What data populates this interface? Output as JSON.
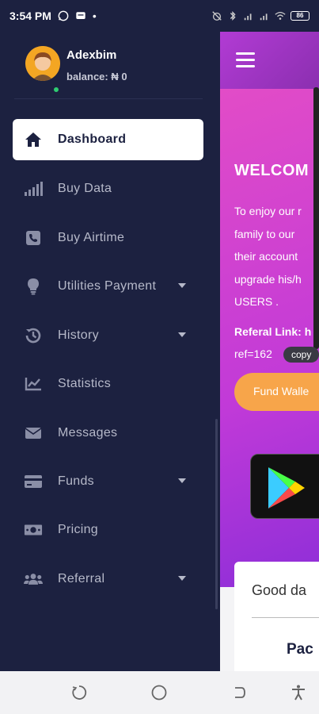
{
  "status_bar": {
    "time": "3:54 PM",
    "battery": "86",
    "dot": "•"
  },
  "drawer": {
    "user_name": "Adexbim",
    "balance": "balance: ₦ 0",
    "items": [
      {
        "label": "Dashboard",
        "icon": "home-icon"
      },
      {
        "label": "Buy Data",
        "icon": "signal-bars-icon"
      },
      {
        "label": "Buy Airtime",
        "icon": "phone-square-icon"
      },
      {
        "label": "Utilities Payment",
        "icon": "lightbulb-icon"
      },
      {
        "label": "History",
        "icon": "history-icon"
      },
      {
        "label": "Statistics",
        "icon": "chart-line-icon"
      },
      {
        "label": "Messages",
        "icon": "envelope-icon"
      },
      {
        "label": "Funds",
        "icon": "credit-card-icon"
      },
      {
        "label": "Pricing",
        "icon": "money-bill-icon"
      },
      {
        "label": "Referral",
        "icon": "users-icon"
      }
    ]
  },
  "content": {
    "welcome": "WELCOM",
    "intro_lines": [
      "To enjoy our r",
      "family to our",
      "their account",
      "upgrade his/h",
      "USERS ."
    ],
    "referral_label": "Referal Link: h",
    "referral_value": "ref=162",
    "copy_label": "copy",
    "fund_button": "Fund Walle",
    "greeting": "Good da",
    "packages_title": "Pac"
  },
  "colors": {
    "drawer_bg": "#1c2140",
    "accent_gradient_start": "#e24cc7",
    "accent_gradient_end": "#8d2ed8",
    "fund_button": "#f7a54a"
  }
}
